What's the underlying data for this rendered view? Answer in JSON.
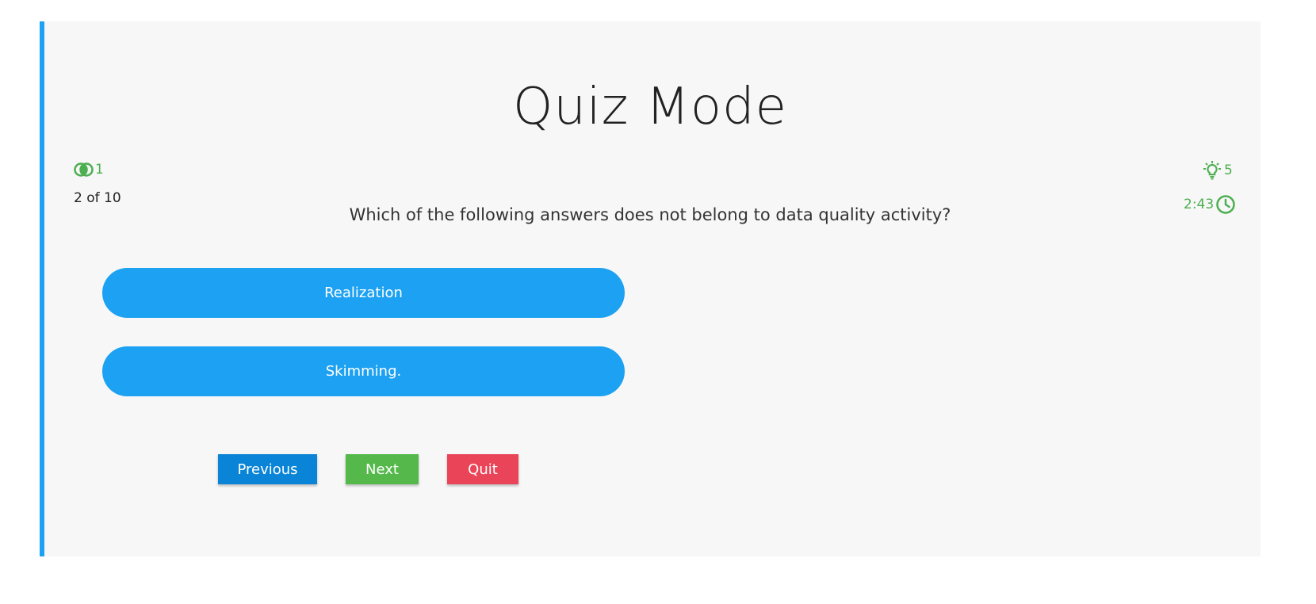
{
  "page": {
    "title": "Quiz Mode"
  },
  "stats": {
    "lives": "1",
    "hints": "5",
    "timer": "2:43",
    "counter": "2 of 10"
  },
  "question": {
    "text": "Which of the following answers does not belong to data quality activity?"
  },
  "answers": [
    {
      "label": "Realization"
    },
    {
      "label": "Skimming."
    }
  ],
  "buttons": {
    "previous": "Previous",
    "next": "Next",
    "quit": "Quit"
  },
  "icons": {
    "lives": "lives-circles-icon",
    "hints": "lightbulb-icon",
    "timer": "clock-icon"
  },
  "colors": {
    "accent": "#1da1f2",
    "stat_green": "#4caf50",
    "previous": "#0a84d6",
    "next": "#54b94a",
    "quit": "#ea4458",
    "card": "#f7f7f7"
  }
}
